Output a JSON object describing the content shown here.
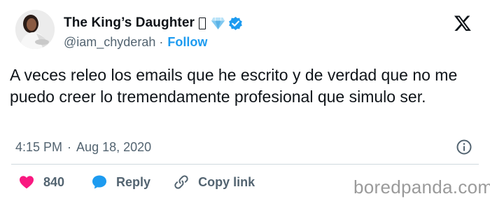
{
  "author": {
    "display_name": "The King’s Daughter",
    "handle": "@iam_chyderah",
    "follow_label": "Follow",
    "separator": "·",
    "badge_colors": {
      "gem": "#7fc8f0",
      "verified": "#1d9bf0"
    }
  },
  "tweet": {
    "text": "A veces releo los emails que he escrito y de verdad que no me puedo creer lo tremendamente profesional que simulo ser.",
    "time": "4:15 PM",
    "date_separator": "·",
    "date": "Aug 18, 2020"
  },
  "actions": {
    "like_count": "840",
    "reply_label": "Reply",
    "copy_link_label": "Copy link",
    "like_color": "#f91880",
    "reply_color": "#1d9bf0"
  },
  "watermark": "boredpanda.com",
  "icons": [
    "x-logo-icon",
    "gem-icon",
    "verified-icon",
    "info-icon",
    "heart-icon",
    "reply-bubble-icon",
    "link-icon"
  ]
}
